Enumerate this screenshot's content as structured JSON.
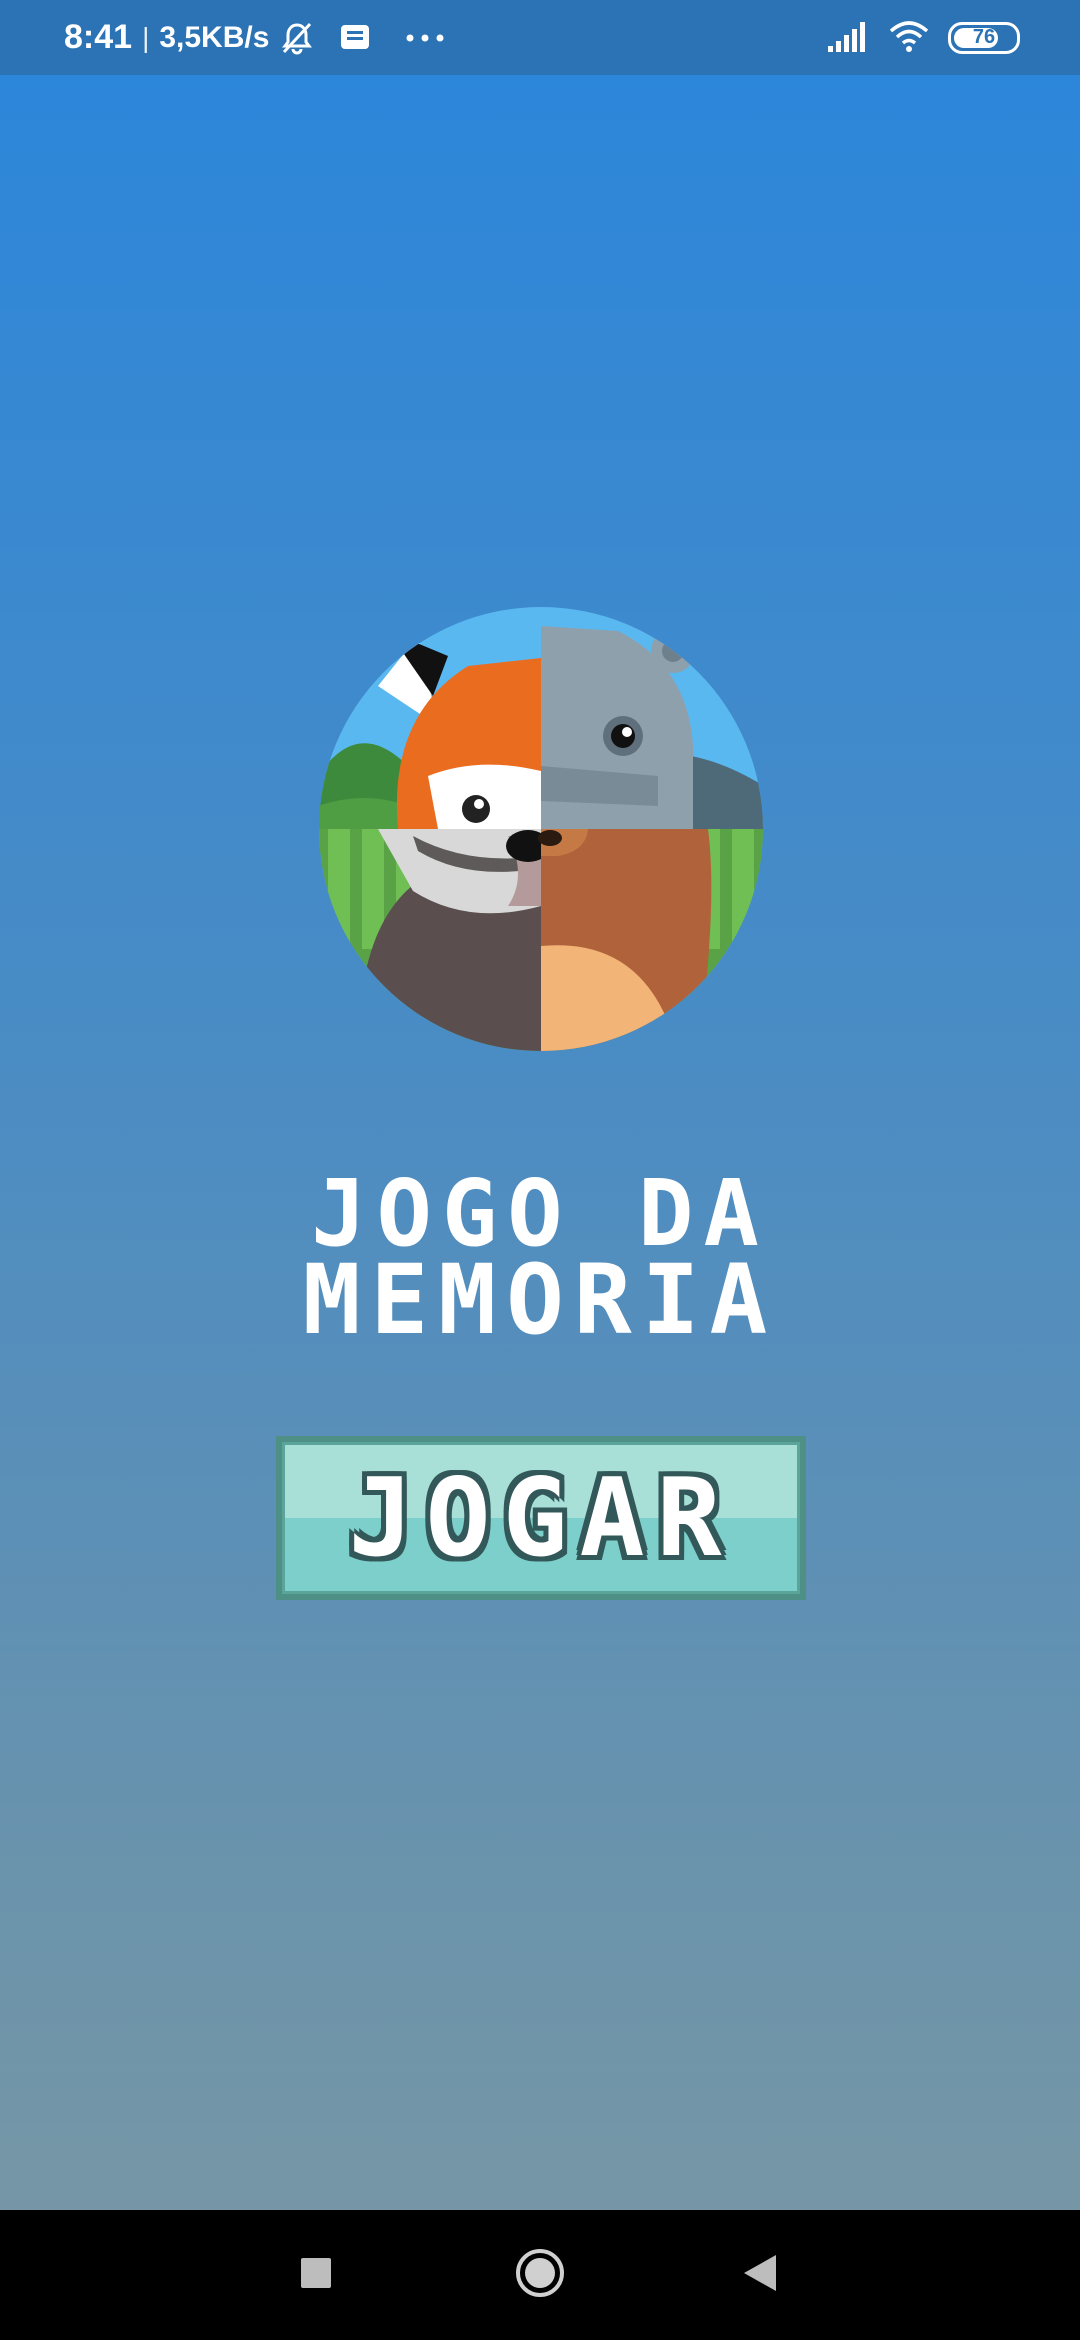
{
  "status_bar": {
    "time": "8:41",
    "separator": "|",
    "network_speed": "3,5KB/s",
    "icons": [
      "muted-bell-icon",
      "notification-icon",
      "more-dots-icon",
      "signal-icon",
      "wifi-icon"
    ],
    "battery_level": "76",
    "battery_fraction": 0.76
  },
  "app": {
    "logo_icon": "animals-logo-icon",
    "title_line1": "JOGO DA",
    "title_line2": "MEMORIA",
    "play_button_label": "JOGAR"
  },
  "nav_bar": {
    "icons": [
      "recents-square-icon",
      "home-circle-icon",
      "back-triangle-icon"
    ]
  },
  "colors": {
    "background_top": "#2a86dc",
    "background_bottom": "#7a98a4",
    "status_bar": "#2b73b4",
    "button_fill": "#7ccfcb",
    "button_border": "#4e8f86"
  }
}
